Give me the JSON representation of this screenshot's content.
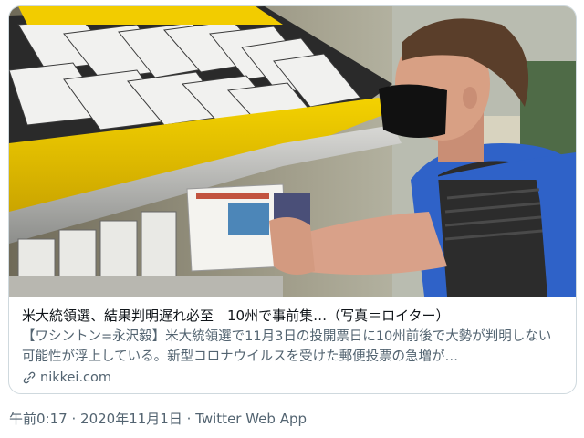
{
  "card": {
    "image": "news-photo",
    "title": "米大統領選、結果判明遅れ必至　10州で事前集…（写真＝ロイター）",
    "description": "【ワシントン=永沢毅】米大統領選で11月3日の投開票日に10州前後で大勢が判明しない可能性が浮上している。新型コロナウイルスを受けた郵便投票の急増が…",
    "domain": "nikkei.com",
    "domain_icon": "link-icon"
  },
  "tweet_meta": {
    "time": "午前0:17",
    "separator": "·",
    "date": "2020年11月1日",
    "source": "Twitter Web App"
  },
  "colors": {
    "border": "#cfd9de",
    "secondary_text": "#536471",
    "primary_text": "#0f1419",
    "accent_yellow": "#e8c000",
    "vest_blue": "#2f62c8"
  }
}
